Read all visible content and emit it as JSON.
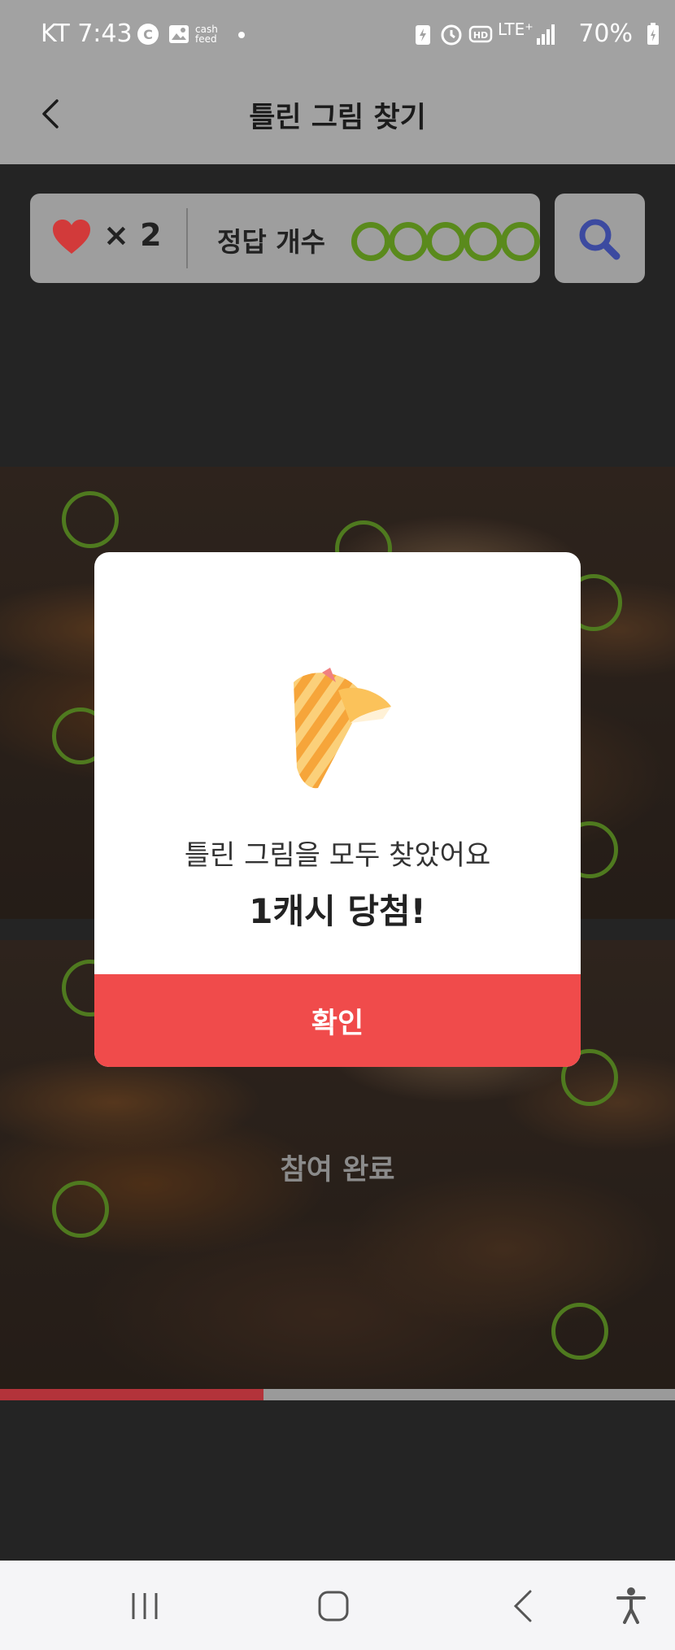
{
  "status_bar": {
    "carrier_time": "KT 7:43",
    "feed_label": "cash feed",
    "network": "LTE⁺",
    "battery": "70%"
  },
  "header": {
    "title": "틀린 그림 찾기"
  },
  "game": {
    "lives": "× 2",
    "answer_count_label": "정답 개수",
    "answers_found": 5,
    "answers_total": 5
  },
  "modal": {
    "message": "틀린 그림을 모두 찾았어요",
    "prize": "1캐시 당첨!",
    "confirm_label": "확인"
  },
  "participation_label": "참여 완료",
  "progress": 0.39,
  "colors": {
    "accent": "#f04b4b",
    "answer_circle": "#5a8a1c",
    "search_icon": "#3c4aa0",
    "heart": "#d23a3a"
  },
  "icons": {
    "back": "chevron-left",
    "heart": "heart",
    "search": "magnifier",
    "prize": "striped-cone",
    "nav_recents": "recents",
    "nav_home": "home",
    "nav_back": "back",
    "nav_accessibility": "accessibility"
  }
}
